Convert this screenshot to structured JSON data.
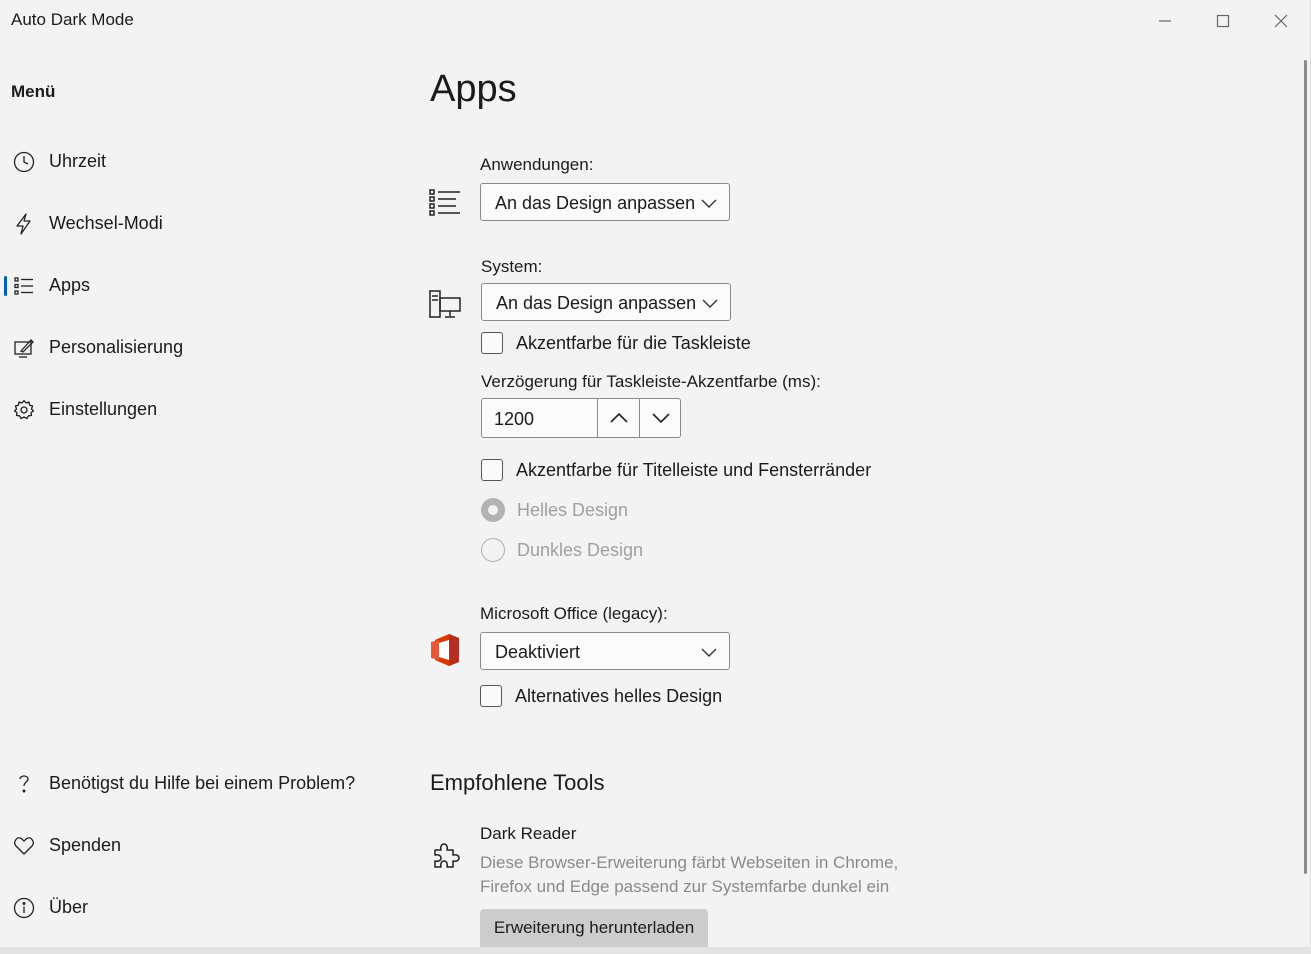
{
  "window": {
    "title": "Auto Dark Mode",
    "controls": {
      "minimize": "minimize-icon",
      "maximize": "maximize-icon",
      "close": "close-icon"
    }
  },
  "sidebar": {
    "title": "Menü",
    "items": [
      {
        "label": "Uhrzeit",
        "icon": "clock-icon"
      },
      {
        "label": "Wechsel-Modi",
        "icon": "lightning-icon"
      },
      {
        "label": "Apps",
        "icon": "list-icon",
        "selected": true
      },
      {
        "label": "Personalisierung",
        "icon": "personalize-icon"
      },
      {
        "label": "Einstellungen",
        "icon": "gear-icon"
      }
    ],
    "footer": [
      {
        "label": "Benötigst du Hilfe bei einem Problem?",
        "icon": "help-icon"
      },
      {
        "label": "Spenden",
        "icon": "heart-icon"
      },
      {
        "label": "Über",
        "icon": "info-icon"
      }
    ]
  },
  "main": {
    "title": "Apps",
    "apps": {
      "label": "Anwendungen:",
      "value": "An das Design anpassen"
    },
    "system": {
      "label": "System:",
      "value": "An das Design anpassen",
      "taskbar_accent_label": "Akzentfarbe für die Taskleiste",
      "taskbar_accent_checked": false,
      "delay_label": "Verzögerung für Taskleiste-Akzentfarbe (ms):",
      "delay_value": "1200",
      "titlebar_accent_label": "Akzentfarbe für Titelleiste und Fensterränder",
      "titlebar_accent_checked": false,
      "radio_light": "Helles Design",
      "radio_dark": "Dunkles Design",
      "radio_selected": "light"
    },
    "office": {
      "label": "Microsoft Office (legacy):",
      "value": "Deaktiviert",
      "alt_light_label": "Alternatives helles Design",
      "alt_light_checked": false
    },
    "recommended": {
      "heading": "Empfohlene Tools",
      "tool_name": "Dark Reader",
      "tool_desc": "Diese Browser-Erweiterung färbt Webseiten in Chrome, Firefox und Edge passend zur Systemfarbe dunkel ein",
      "button": "Erweiterung herunterladen"
    }
  },
  "colors": {
    "accent": "#005fb8",
    "background": "#f3f3f3",
    "office_red": "#d83b01"
  }
}
